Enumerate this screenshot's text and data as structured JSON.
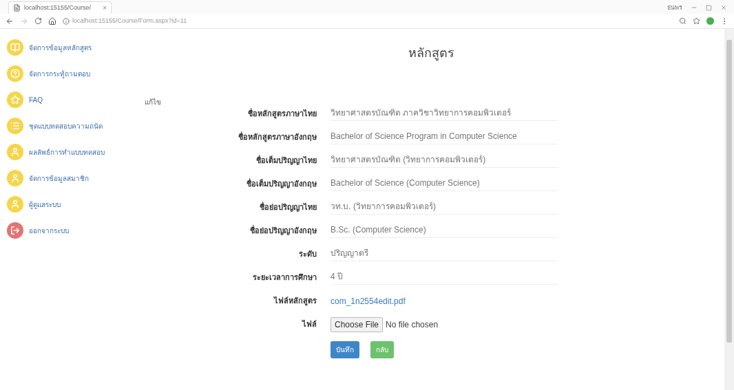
{
  "browser": {
    "tab_title": "localhost:15155/Course/",
    "tab_close": "×",
    "address": "localhost:15155/Course/Form.aspx?id=11",
    "profile": "ธนพร"
  },
  "sidebar": {
    "items": [
      {
        "label": "จัดการข้อมูลหลักสูตร",
        "kind": "book",
        "color": "#f6d54a"
      },
      {
        "label": "จัดการกระทู้ถามตอบ",
        "kind": "question",
        "color": "#f6d54a"
      },
      {
        "label": "FAQ",
        "kind": "star",
        "color": "#f6d54a"
      },
      {
        "label": "ชุดแบบทดสอบความถนัด",
        "kind": "list",
        "color": "#f6d54a"
      },
      {
        "label": "ผลลัพธ์การทำแบบทดสอบ",
        "kind": "user",
        "color": "#f6d54a"
      },
      {
        "label": "จัดการข้อมูลสมาชิก",
        "kind": "user",
        "color": "#f6d54a"
      },
      {
        "label": "ผู้ดูแลระบบ",
        "kind": "user",
        "color": "#f6d54a"
      },
      {
        "label": "ออกจากระบบ",
        "kind": "logout",
        "color": "#e57373"
      }
    ]
  },
  "mode_label": "แก้ไข",
  "form": {
    "title": "หลักสูตร",
    "rows": [
      {
        "label": "ชื่อหลักสูตรภาษาไทย",
        "kind": "text",
        "value": "วิทยาศาสตรบัณฑิต ภาควิชาวิทยาการคอมพิวเตอร์"
      },
      {
        "label": "ชื่อหลักสูตรภาษาอังกฤษ",
        "kind": "text",
        "value": "Bachelor of Science Program in Computer Science"
      },
      {
        "label": "ชื่อเต็มปริญญาไทย",
        "kind": "text",
        "value": "วิทยาศาสตรบัณฑิต (วิทยาการคอมพิวเตอร์)"
      },
      {
        "label": "ชื่อเต็มปริญญาอังกฤษ",
        "kind": "text",
        "value": "Bachelor of Science (Computer Science)"
      },
      {
        "label": "ชื่อย่อปริญญาไทย",
        "kind": "text",
        "value": "วท.บ. (วิทยาการคอมพิวเตอร์)"
      },
      {
        "label": "ชื่อย่อปริญญาอังกฤษ",
        "kind": "text",
        "value": "B.Sc. (Computer Science)"
      },
      {
        "label": "ระดับ",
        "kind": "text",
        "value": "ปริญญาตรี"
      },
      {
        "label": "ระยะเวลาการศึกษา",
        "kind": "text",
        "value": "4 ปี"
      },
      {
        "label": "ไฟล์หลักสูตร",
        "kind": "link",
        "value": "com_1n2554edit.pdf"
      },
      {
        "label": "ไฟล์",
        "kind": "file",
        "button": "Choose File",
        "value": "No file chosen"
      }
    ],
    "buttons": [
      {
        "label": "บันทึก",
        "kind": "primary"
      },
      {
        "label": "กลับ",
        "kind": "success"
      }
    ]
  }
}
